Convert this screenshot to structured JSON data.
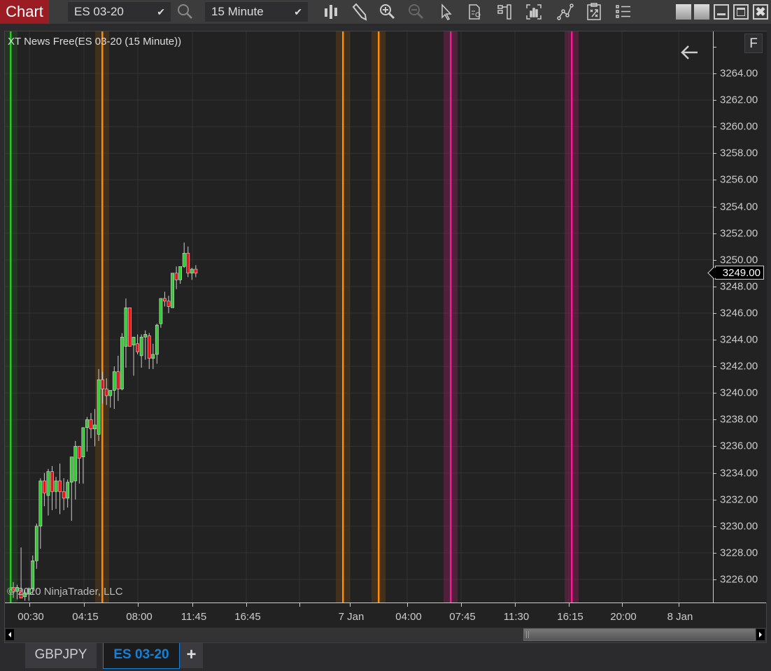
{
  "app": {
    "title": "Chart"
  },
  "toolbar": {
    "instrument": "ES 03-20",
    "interval": "15 Minute",
    "icons": [
      "chart-style-icon",
      "drawing-tool-icon",
      "zoom-in-icon",
      "zoom-out-icon",
      "pointer-icon",
      "data-box-icon",
      "indicators-icon",
      "strategies-icon",
      "chart-trader-icon",
      "properties-icon",
      "templates-icon"
    ],
    "window_buttons": [
      "tile-icon",
      "tile-icon",
      "minimize-icon",
      "maximize-icon",
      "close-icon"
    ]
  },
  "indicator_label": "XT News Free(ES 03-20 (15 Minute))",
  "copyright": "© 2020 NinjaTrader, LLC",
  "f_button": "F",
  "current_price": "3249.00",
  "colors": {
    "up": "#33cc33",
    "down": "#ee1111",
    "wick": "#cccccc",
    "orange_line": "#ff8c00",
    "magenta_line": "#ff1493",
    "green_line": "#22cc22",
    "brand": "#9b1c22",
    "active_tab": "#1a7fd4"
  },
  "tabs": [
    {
      "label": "GBPJPY",
      "active": false
    },
    {
      "label": "ES 03-20",
      "active": true
    },
    {
      "label": "+",
      "active": false
    }
  ],
  "chart_data": {
    "type": "candlestick",
    "title": "XT News Free(ES 03-20 (15 Minute))",
    "ylim": [
      3224.4,
      3267.2
    ],
    "y_ticks": [
      "3264.00",
      "3262.00",
      "3260.00",
      "3258.00",
      "3256.00",
      "3254.00",
      "3252.00",
      "3250.00",
      "3248.00",
      "3246.00",
      "3244.00",
      "3242.00",
      "3240.00",
      "3238.00",
      "3236.00",
      "3234.00",
      "3232.00",
      "3230.00",
      "3228.00",
      "3226.00"
    ],
    "x_ticks": [
      "00:30",
      "04:15",
      "08:00",
      "11:45",
      "16:45",
      "",
      "7 Jan",
      "04:00",
      "07:45",
      "11:30",
      "16:15",
      "20:00",
      "8 Jan"
    ],
    "grid": true,
    "candles": [
      [
        3225.4,
        3225.8,
        3224.6,
        3225.1
      ],
      [
        3225.1,
        3225.6,
        3224.5,
        3225.4
      ],
      [
        3225.2,
        3228.4,
        3224.6,
        3224.6
      ],
      [
        3224.7,
        3225.2,
        3224.4,
        3225.0
      ],
      [
        3224.9,
        3225.4,
        3224.4,
        3225.3
      ],
      [
        3225.3,
        3227.8,
        3224.9,
        3227.4
      ],
      [
        3227.4,
        3230.2,
        3226.8,
        3230.0
      ],
      [
        3230.0,
        3233.6,
        3228.3,
        3233.4
      ],
      [
        3233.4,
        3234.0,
        3231.5,
        3232.5
      ],
      [
        3232.3,
        3234.3,
        3230.8,
        3234.1
      ],
      [
        3234.1,
        3234.5,
        3231.2,
        3232.6
      ],
      [
        3232.6,
        3233.7,
        3231.3,
        3233.4
      ],
      [
        3233.4,
        3234.7,
        3230.9,
        3232.6
      ],
      [
        3232.6,
        3233.6,
        3231.2,
        3232.1
      ],
      [
        3232.1,
        3233.5,
        3231.4,
        3233.3
      ],
      [
        3233.3,
        3234.0,
        3230.4,
        3235.2
      ],
      [
        3233.4,
        3236.4,
        3232.0,
        3236.0
      ],
      [
        3236.0,
        3235.8,
        3233.2,
        3235.1
      ],
      [
        3235.2,
        3237.2,
        3233.2,
        3237.4
      ],
      [
        3237.4,
        3238.2,
        3235.6,
        3238.0
      ],
      [
        3238.0,
        3238.5,
        3236.6,
        3237.3
      ],
      [
        3237.3,
        3238.8,
        3236.0,
        3237.6
      ],
      [
        3236.9,
        3241.8,
        3236.4,
        3241.0
      ],
      [
        3241.0,
        3241.6,
        3239.2,
        3240.3
      ],
      [
        3240.3,
        3241.1,
        3239.1,
        3239.8
      ],
      [
        3239.8,
        3240.2,
        3238.9,
        3240.2
      ],
      [
        3240.2,
        3242.0,
        3238.8,
        3241.6
      ],
      [
        3241.6,
        3242.8,
        3239.4,
        3240.3
      ],
      [
        3240.3,
        3244.5,
        3240.2,
        3244.2
      ],
      [
        3243.5,
        3247.1,
        3241.9,
        3246.4
      ],
      [
        3246.4,
        3243.5,
        3243.5,
        3243.5
      ],
      [
        3243.6,
        3244.2,
        3241.3,
        3244.2
      ],
      [
        3243.7,
        3244.4,
        3242.9,
        3243.1
      ],
      [
        3242.8,
        3244.4,
        3241.9,
        3244.2
      ],
      [
        3244.2,
        3244.7,
        3242.5,
        3244.4
      ],
      [
        3244.3,
        3244.5,
        3241.8,
        3242.6
      ],
      [
        3242.6,
        3243.7,
        3241.8,
        3242.9
      ],
      [
        3242.9,
        3245.2,
        3242.2,
        3245.1
      ],
      [
        3245.2,
        3247.1,
        3244.9,
        3247.1
      ],
      [
        3247.1,
        3247.6,
        3246.5,
        3246.9
      ],
      [
        3246.9,
        3247.3,
        3246.0,
        3246.5
      ],
      [
        3246.4,
        3247.5,
        3246.4,
        3249.0
      ],
      [
        3249.0,
        3249.5,
        3247.8,
        3248.5
      ],
      [
        3248.5,
        3249.5,
        3248.2,
        3249.5
      ],
      [
        3249.5,
        3251.3,
        3249.4,
        3250.5
      ],
      [
        3250.5,
        3251.0,
        3248.7,
        3249.0
      ],
      [
        3249.0,
        3249.4,
        3248.5,
        3249.3
      ],
      [
        3249.3,
        3249.6,
        3248.7,
        3249.0
      ]
    ],
    "news_markers": [
      {
        "time": "before 00:30",
        "color": "green"
      },
      {
        "time": "~05:30",
        "color": "orange"
      },
      {
        "time": "7 Jan ~00:30",
        "color": "orange"
      },
      {
        "time": "7 Jan ~02:45",
        "color": "orange"
      },
      {
        "time": "7 Jan ~07:15",
        "color": "magenta"
      },
      {
        "time": "7 Jan ~16:00",
        "color": "magenta"
      }
    ]
  }
}
